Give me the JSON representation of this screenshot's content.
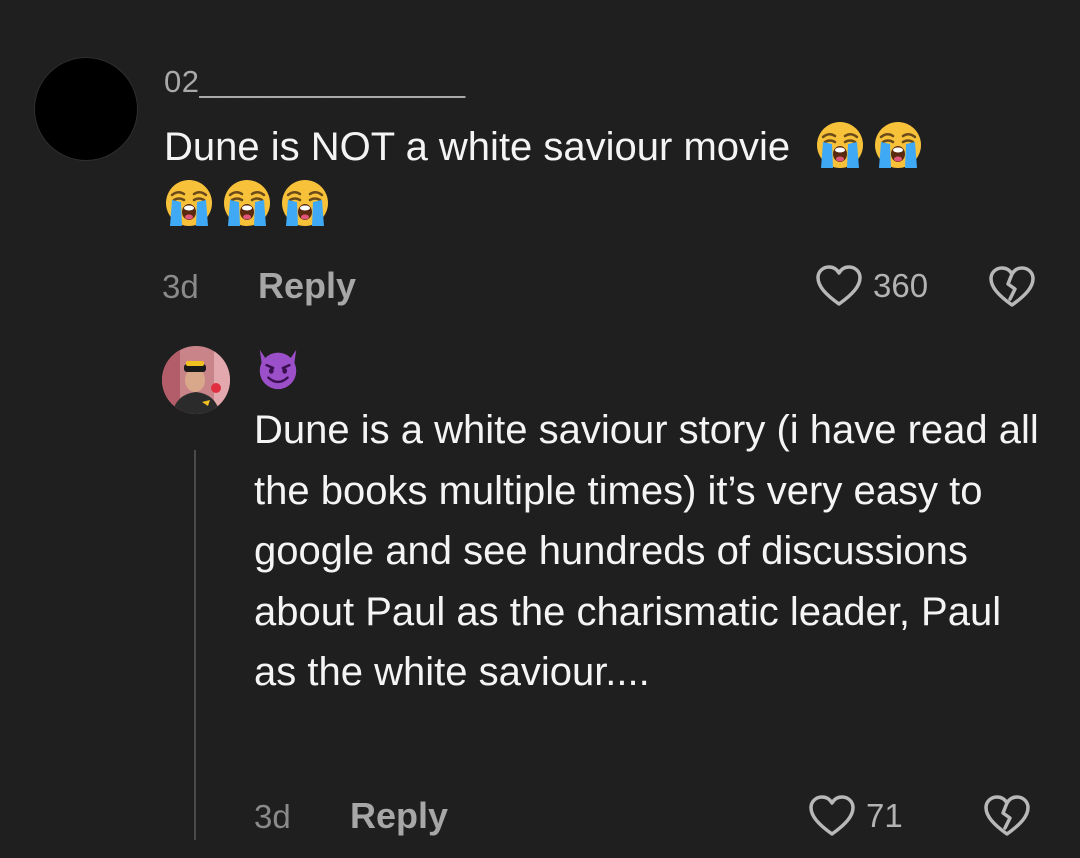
{
  "comment": {
    "username": "02_______________",
    "text": "Dune is NOT a white saviour movie",
    "emojis": [
      "loudly-crying-face",
      "loudly-crying-face",
      "loudly-crying-face",
      "loudly-crying-face",
      "loudly-crying-face"
    ],
    "time": "3d",
    "reply_label": "Reply",
    "like_count": "360"
  },
  "reply": {
    "emoji": "smiling-face-with-horns",
    "text": "Dune is a white saviour story (i have read all the books multiple times) it’s very easy to google and see hundreds of discussions about Paul as the charismatic leader, Paul as the white saviour....",
    "time": "3d",
    "reply_label": "Reply",
    "like_count": "71"
  },
  "colors": {
    "background": "#1f1f1f",
    "text": "#f4f4f4",
    "muted": "#8a8a8a"
  }
}
